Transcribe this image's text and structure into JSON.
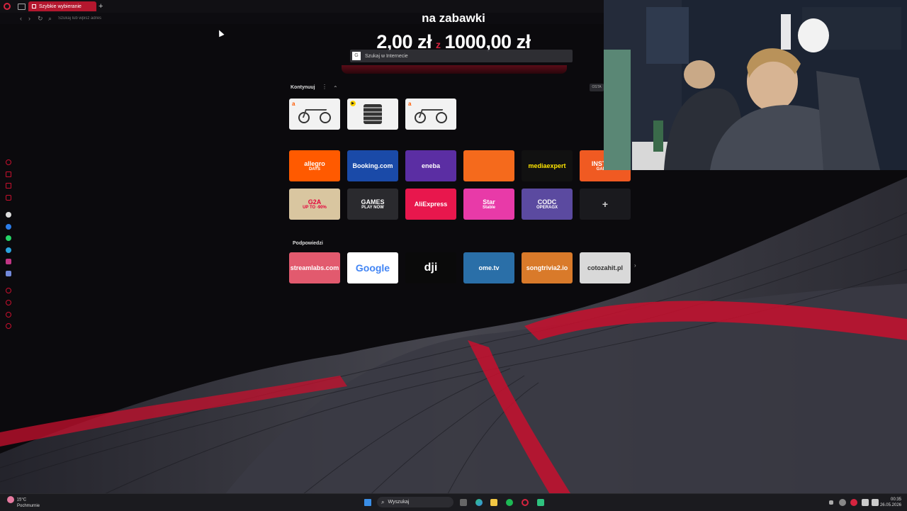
{
  "tabbar": {
    "active_tab": "Szybkie wybieranie",
    "add_tab": "+"
  },
  "addressbar": {
    "placeholder": "Szukaj lub wpisz adres"
  },
  "promo": {
    "title": "na zabawki",
    "price_from": "2,00 zł",
    "price_sep": "z",
    "price_to": "1000,00 zł"
  },
  "search_suggest": {
    "label": "Szukaj w Internecie",
    "icon": "G"
  },
  "continue": {
    "label": "Kontynuuj",
    "menu": "⋮",
    "collapse": "⌃",
    "recent_badge": "OSTA"
  },
  "speed_dial": [
    {
      "name": "allegro",
      "line1": "allegro",
      "line2": "DAYS",
      "bg": "#ff5a00",
      "color": "#fff"
    },
    {
      "name": "booking",
      "line1": "Booking.com",
      "line2": "",
      "bg": "#1a4aa8",
      "color": "#fff"
    },
    {
      "name": "eneba",
      "line1": "eneba",
      "line2": "",
      "bg": "#5b2ea3",
      "color": "#fff"
    },
    {
      "name": "aliexpress-icon",
      "line1": "",
      "line2": "",
      "bg": "#f56a1c",
      "color": "#fff"
    },
    {
      "name": "mediaexpert",
      "line1": "mediaexpert",
      "line2": "",
      "bg": "#111",
      "color": "#ffe600"
    },
    {
      "name": "instant-gaming",
      "line1": "INSTANT",
      "line2": "GAMING",
      "bg": "#f05a22",
      "color": "#fff"
    },
    {
      "name": "g2a",
      "line1": "G2A",
      "line2": "UP TO -90%",
      "bg": "#d9c6a0",
      "color": "#e4003a"
    },
    {
      "name": "cd-games",
      "line1": "GAMES",
      "line2": "PLAY NOW",
      "bg": "#2a2a2e",
      "color": "#fff"
    },
    {
      "name": "aliexpress",
      "line1": "AliExpress",
      "line2": "",
      "bg": "#e8174d",
      "color": "#fff"
    },
    {
      "name": "star-stable",
      "line1": "Star",
      "line2": "Stable",
      "bg": "#e83aa8",
      "color": "#fff"
    },
    {
      "name": "codashop",
      "line1": "CODC",
      "line2": "OPERAGX",
      "bg": "#5b4aa0",
      "color": "#fff"
    },
    {
      "name": "add-site",
      "line1": "+",
      "line2": "",
      "bg": "#1a1a1e",
      "color": "#ccc"
    }
  ],
  "suggestions": {
    "label": "Podpowiedzi",
    "items": [
      {
        "name": "streamlabs",
        "text": "streamlabs.com",
        "bg": "#e25a6e",
        "color": "#fff"
      },
      {
        "name": "google",
        "text": "Google",
        "bg": "#ffffff",
        "color": "#4285f4"
      },
      {
        "name": "dji",
        "text": "dji",
        "bg": "#0a0a0a",
        "color": "#fff"
      },
      {
        "name": "ome-tv",
        "text": "ome.tv",
        "bg": "#2a6fa8",
        "color": "#fff"
      },
      {
        "name": "songtrivia",
        "text": "songtrivia2.io",
        "bg": "#d97a2a",
        "color": "#fff"
      },
      {
        "name": "cotozahit",
        "text": "cotozahit.pl",
        "bg": "#d9d9d9",
        "color": "#333"
      }
    ],
    "next": "›"
  },
  "taskbar": {
    "weather_temp": "15°C",
    "weather_desc": "Pochmurnie",
    "search": "Wyszukaj",
    "time": "00:35",
    "date": "26.05.2026"
  }
}
